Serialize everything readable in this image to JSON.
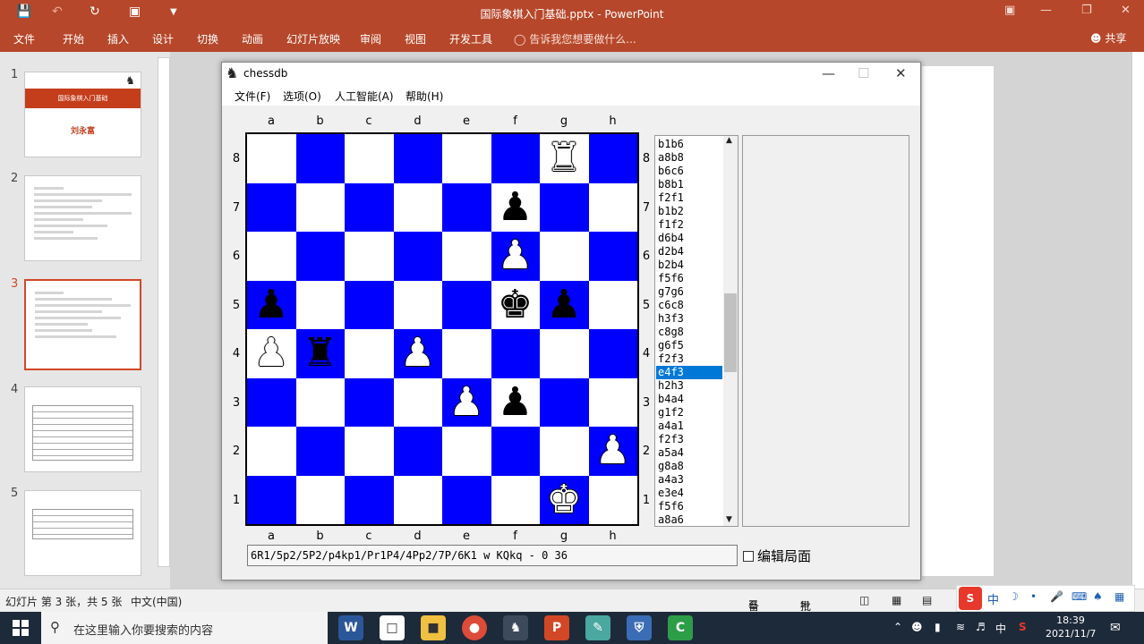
{
  "app": {
    "doc_title": "国际象棋入门基础.pptx - PowerPoint",
    "ribbon_tabs": [
      "文件",
      "开始",
      "插入",
      "设计",
      "切换",
      "动画",
      "幻灯片放映",
      "审阅",
      "视图",
      "开发工具"
    ],
    "tell_me": "告诉我您想要做什么...",
    "share": "共享"
  },
  "thumbnails": [
    {
      "num": "1",
      "title": "国际象棋入门基础",
      "author": "刘永富"
    },
    {
      "num": "2"
    },
    {
      "num": "3"
    },
    {
      "num": "4"
    },
    {
      "num": "5"
    }
  ],
  "status": {
    "slide_info": "幻灯片 第 3 张，共 5 张",
    "language": "中文(中国)",
    "notes": "备注",
    "comments": "批注"
  },
  "chess_window": {
    "title": "chessdb",
    "menu": [
      "文件(F)",
      "选项(O)",
      "人工智能(A)",
      "帮助(H)"
    ],
    "files": [
      "a",
      "b",
      "c",
      "d",
      "e",
      "f",
      "g",
      "h"
    ],
    "ranks": [
      "8",
      "7",
      "6",
      "5",
      "4",
      "3",
      "2",
      "1"
    ],
    "pieces": [
      {
        "square": "g8",
        "glyph": "♜",
        "color": "white"
      },
      {
        "square": "f7",
        "glyph": "♟",
        "color": "black"
      },
      {
        "square": "f6",
        "glyph": "♟",
        "color": "white"
      },
      {
        "square": "a5",
        "glyph": "♟",
        "color": "black"
      },
      {
        "square": "f5",
        "glyph": "♚",
        "color": "black"
      },
      {
        "square": "g5",
        "glyph": "♟",
        "color": "black"
      },
      {
        "square": "a4",
        "glyph": "♟",
        "color": "white"
      },
      {
        "square": "b4",
        "glyph": "♜",
        "color": "black"
      },
      {
        "square": "d4",
        "glyph": "♟",
        "color": "white"
      },
      {
        "square": "e3",
        "glyph": "♟",
        "color": "white"
      },
      {
        "square": "f3",
        "glyph": "♟",
        "color": "black"
      },
      {
        "square": "h2",
        "glyph": "♟",
        "color": "white"
      },
      {
        "square": "g1",
        "glyph": "♚",
        "color": "white"
      }
    ],
    "moves": [
      "b1b6",
      "a8b8",
      "b6c6",
      "b8b1",
      "f2f1",
      "b1b2",
      "f1f2",
      "d6b4",
      "d2b4",
      "b2b4",
      "f5f6",
      "g7g6",
      "c6c8",
      "h3f3",
      "c8g8",
      "g6f5",
      "f2f3",
      "e4f3",
      "h2h3",
      "b4a4",
      "g1f2",
      "a4a1",
      "f2f3",
      "a5a4",
      "g8a8",
      "a4a3",
      "e3e4",
      "f5f6",
      "a8a6"
    ],
    "selected_move": "e4f3",
    "fen": "6R1/5p2/5P2/p4kp1/Pr1P4/4Pp2/7P/6K1 w KQkq - 0 36",
    "edit_checkbox_label": "编辑局面"
  },
  "taskbar": {
    "search_placeholder": "在这里输入你要搜索的内容",
    "time": "18:39",
    "date": "2021/11/7",
    "ime": "中"
  }
}
